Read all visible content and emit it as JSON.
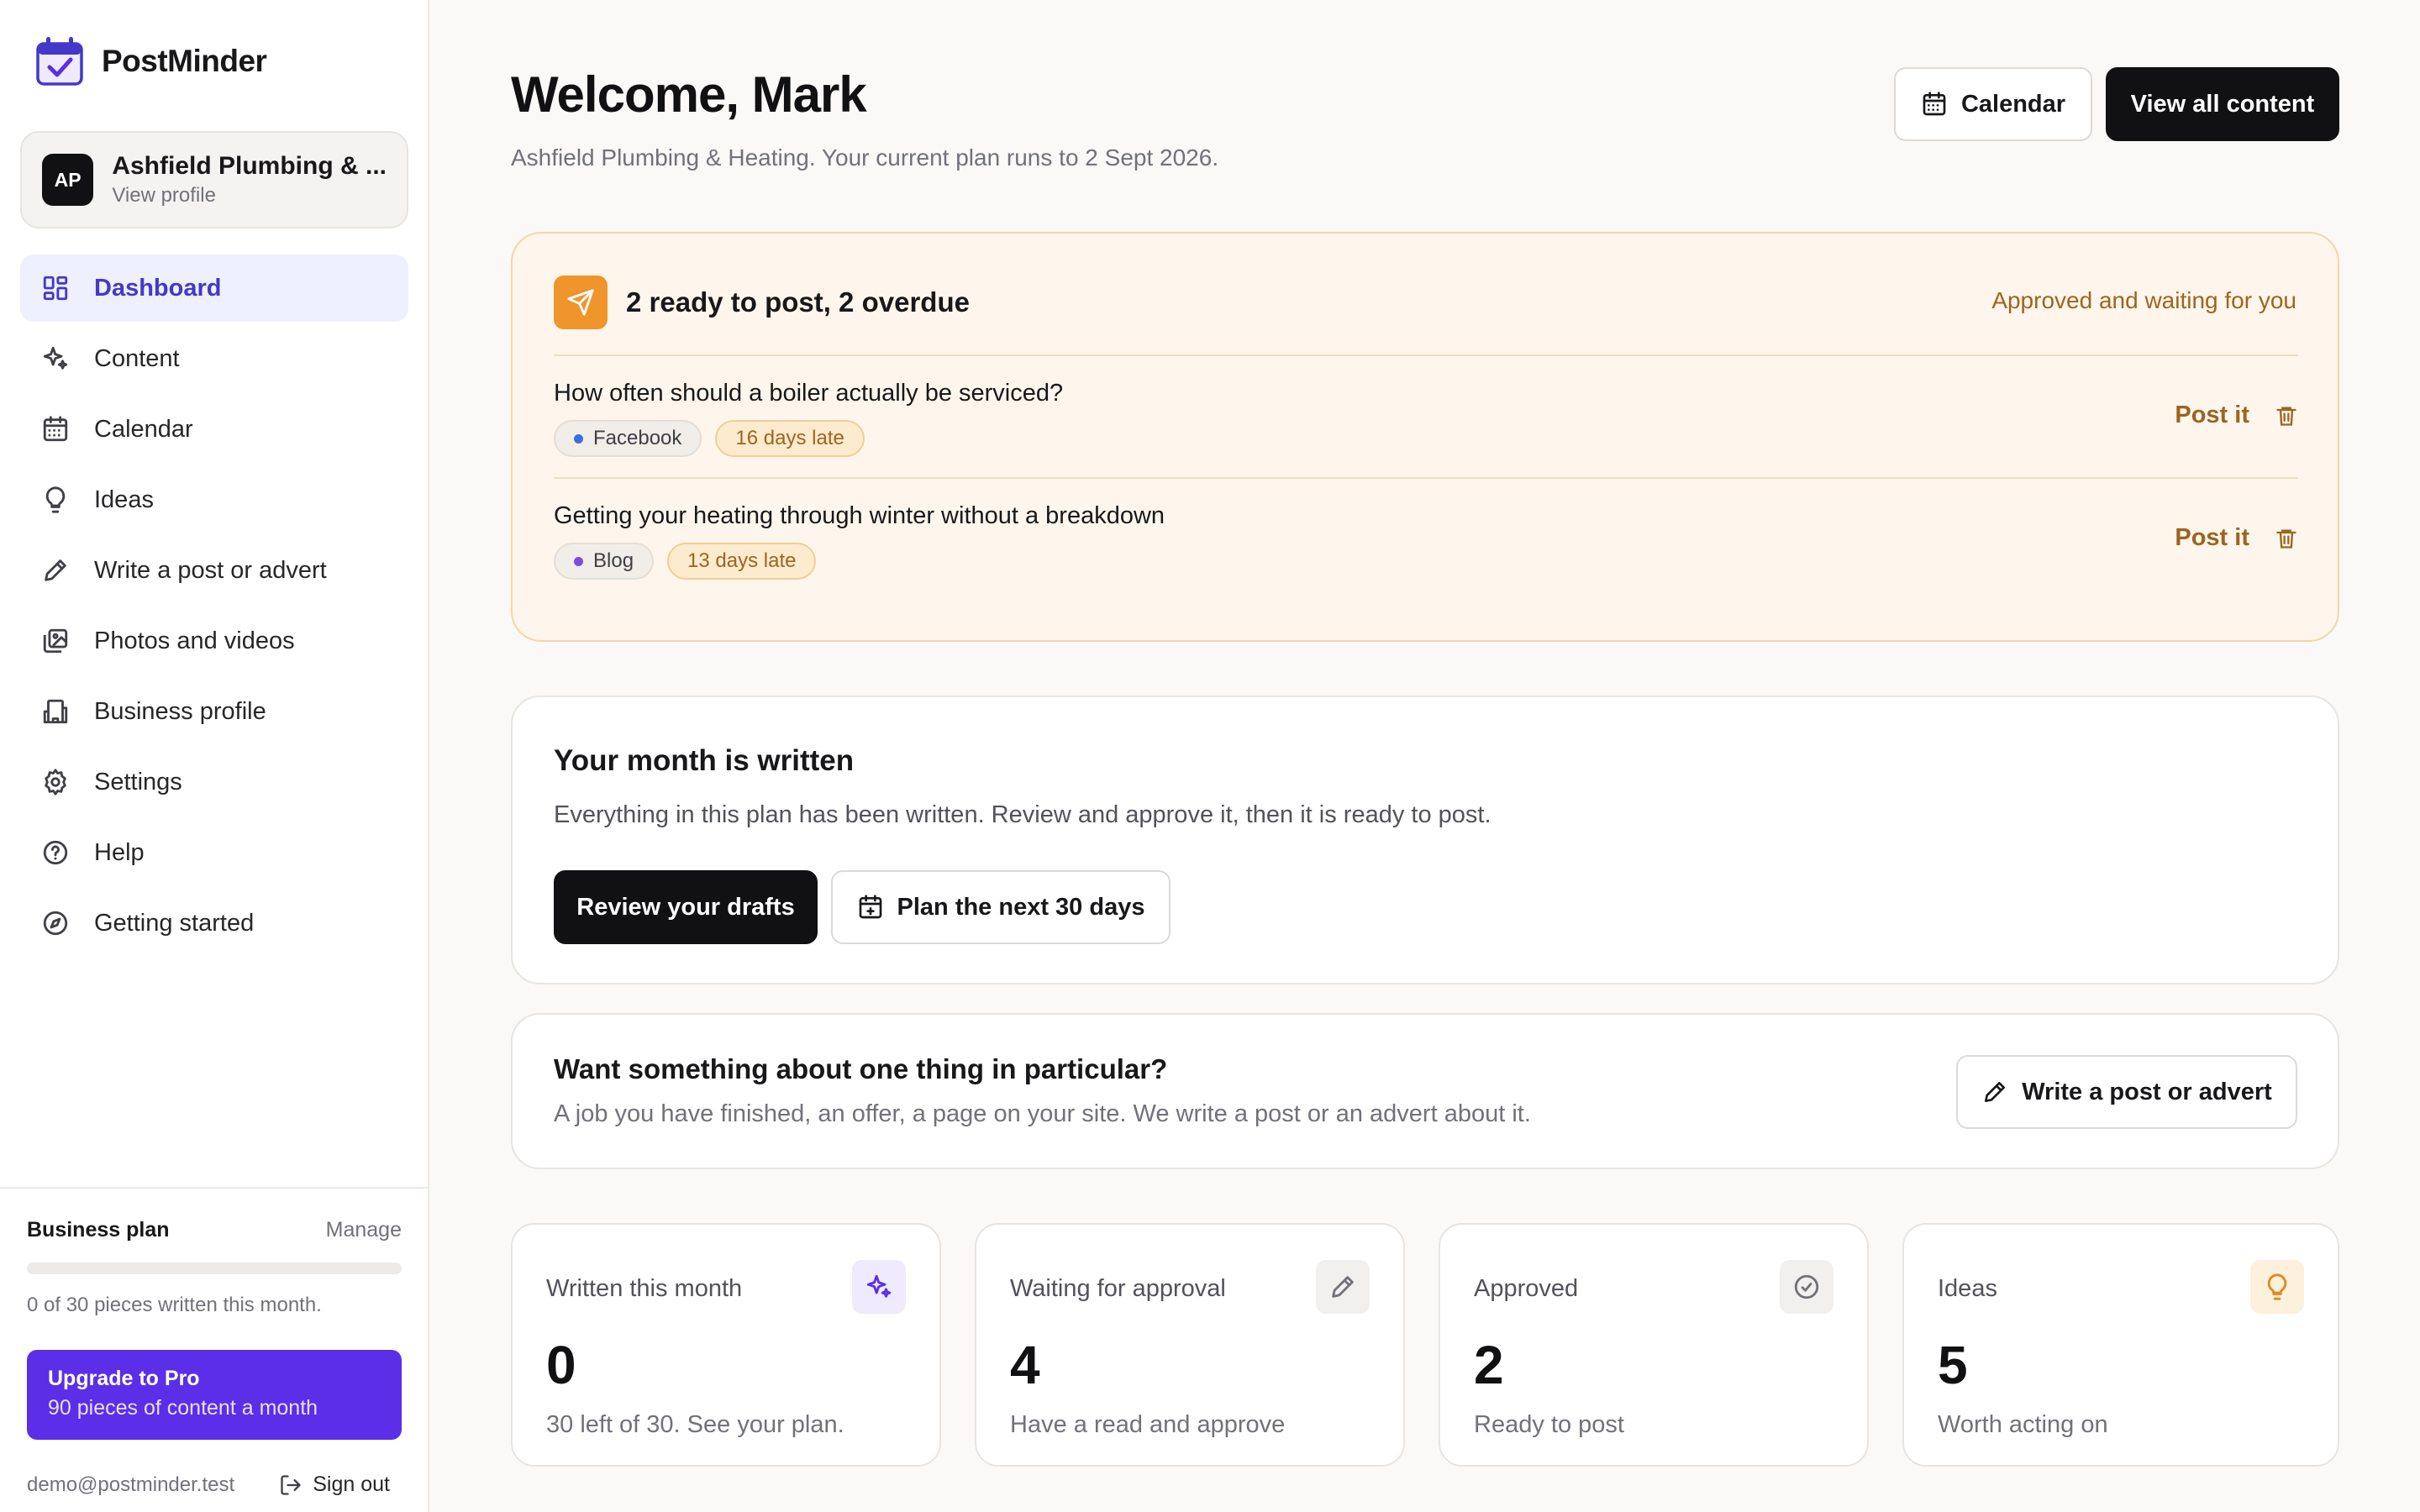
{
  "app": {
    "name": "PostMinder"
  },
  "profile": {
    "initials": "AP",
    "name": "Ashfield Plumbing & ...",
    "sub": "View profile"
  },
  "nav": [
    {
      "label": "Dashboard",
      "icon": "dashboard-icon",
      "active": true
    },
    {
      "label": "Content",
      "icon": "sparkles-icon"
    },
    {
      "label": "Calendar",
      "icon": "calendar-icon"
    },
    {
      "label": "Ideas",
      "icon": "lightbulb-icon"
    },
    {
      "label": "Write a post or advert",
      "icon": "pen-icon"
    },
    {
      "label": "Photos and videos",
      "icon": "images-icon"
    },
    {
      "label": "Business profile",
      "icon": "building-icon"
    },
    {
      "label": "Settings",
      "icon": "gear-icon"
    },
    {
      "label": "Help",
      "icon": "help-circle-icon"
    },
    {
      "label": "Getting started",
      "icon": "compass-icon"
    }
  ],
  "plan": {
    "title": "Business plan",
    "manage": "Manage",
    "progress_fraction": 0,
    "note": "0 of 30 pieces written this month.",
    "upgrade_title": "Upgrade to Pro",
    "upgrade_sub": "90 pieces of content a month",
    "email": "demo@postminder.test",
    "signout": "Sign out"
  },
  "header": {
    "title": "Welcome, Mark",
    "subtitle": "Ashfield Plumbing & Heating. Your current plan runs to 2 Sept 2026.",
    "calendar_btn": "Calendar",
    "view_all_btn": "View all content"
  },
  "alert": {
    "title": "2 ready to post, 2 overdue",
    "note": "Approved and waiting for you",
    "post_label": "Post it",
    "items": [
      {
        "question": "How often should a boiler actually be serviced?",
        "channel": "Facebook",
        "channel_color": "#3b6fd8",
        "late": "16 days late"
      },
      {
        "question": "Getting your heating through winter without a breakdown",
        "channel": "Blog",
        "channel_color": "#7c4ddf",
        "late": "13 days late"
      }
    ]
  },
  "month_card": {
    "title": "Your month is written",
    "text": "Everything in this plan has been written. Review and approve it, then it is ready to post.",
    "review_btn": "Review your drafts",
    "plan_btn": "Plan the next 30 days"
  },
  "wants_card": {
    "title": "Want something about one thing in particular?",
    "text": "A job you have finished, an offer, a page on your site. We write a post or an advert about it.",
    "btn": "Write a post or advert"
  },
  "stats": [
    {
      "label": "Written this month",
      "value": "0",
      "sub": "30 left of 30. See your plan.",
      "icon": "sparkles-icon",
      "icon_bg": "#efeafd",
      "icon_color": "#5b2ee8"
    },
    {
      "label": "Waiting for approval",
      "value": "4",
      "sub": "Have a read and approve",
      "icon": "pen-icon",
      "icon_bg": "#f1f0ee",
      "icon_color": "#71717a"
    },
    {
      "label": "Approved",
      "value": "2",
      "sub": "Ready to post",
      "icon": "check-circle-icon",
      "icon_bg": "#f1f0ee",
      "icon_color": "#71717a"
    },
    {
      "label": "Ideas",
      "value": "5",
      "sub": "Worth acting on",
      "icon": "lightbulb-icon",
      "icon_bg": "#fdf0dc",
      "icon_color": "#e08a1e"
    }
  ],
  "colors": {
    "accent": "#5b2ee8",
    "alert_bg": "#fef6ec",
    "alert_icon": "#f0942c",
    "dark": "#111113"
  }
}
